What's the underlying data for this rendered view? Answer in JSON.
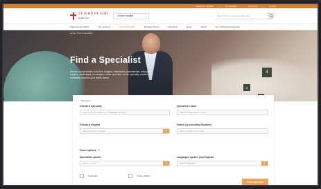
{
  "utility_bar": {
    "links": [
      "Search our hospitals",
      "Our hospitals",
      "Job search",
      "Contact"
    ]
  },
  "header": {
    "logo_line1": "ST JOHN OF GOD",
    "logo_line2": "Health Care",
    "choose_hospital_label": "Choose hospital",
    "choose_hospital_chevron": "›",
    "site_search_placeholder": "Search St John of God Health Care"
  },
  "nav": {
    "items": [
      {
        "label": "Patients and visitors",
        "active": false
      },
      {
        "label": "Our services",
        "active": false
      },
      {
        "label": "Find a Specialist",
        "active": true
      },
      {
        "label": "Working with us",
        "active": false
      },
      {
        "label": "Research",
        "active": false
      },
      {
        "label": "News",
        "active": false
      },
      {
        "label": "About",
        "active": false
      },
      {
        "label": "For medical professionals",
        "active": false
      }
    ]
  },
  "hero": {
    "breadcrumb": "Home  /  Find a Specialist",
    "title": "Find a Specialist",
    "description": "Browse our specialists to find the surgeon, obstetrician, paediatrician, orthopaedic surgeon, cardiologist, oncologist or other specialist, whose speciality, location and availability matches your health needs.",
    "room_numbers": [
      "4",
      "3",
      "1"
    ]
  },
  "form": {
    "required_note": "* Mandatory",
    "speciality": {
      "label": "Choose a speciality",
      "placeholder": "Start typing a speciality (e.g. 'orthopaedic surgeon')"
    },
    "specialist_name": {
      "label": "Specialist's name",
      "placeholder": "Search for specialists by name"
    },
    "hospital": {
      "label": "Choose a hospital",
      "placeholder": "Select one of our hospitals"
    },
    "location": {
      "label": "Search by consulting locations",
      "placeholder": "Enter a suburb or post code"
    },
    "more_options_label": "Fewer options",
    "more_options_chevron": "▾",
    "gender": {
      "label": "Specialist's gender",
      "placeholder": "Select a gender"
    },
    "languages": {
      "label": "Languages spoken (non English)",
      "placeholder": "Select a language"
    },
    "checkbox_1": "Telehealth",
    "checkbox_2": "Treats children",
    "submit_label": "Find a Specialist"
  },
  "colors": {
    "accent": "#d47f2e",
    "button": "#e8a25a",
    "brand_red": "#b8272b"
  }
}
